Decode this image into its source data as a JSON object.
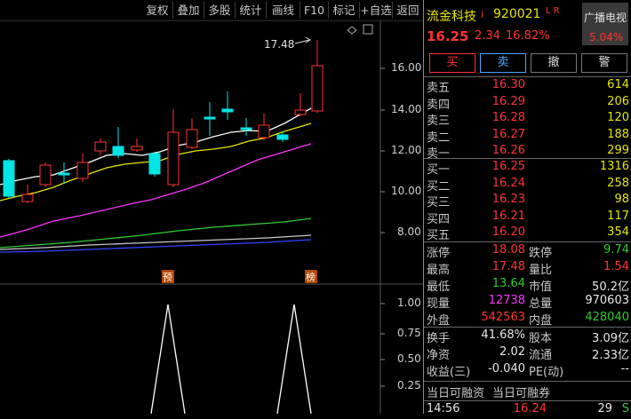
{
  "toolbar": {
    "buttons": [
      "复权",
      "叠加",
      "多股",
      "统计",
      "画线",
      "F10",
      "标记",
      "+自选",
      "返回"
    ]
  },
  "chart": {
    "price_axis": [
      "16.00",
      "14.00",
      "12.00",
      "10.00",
      "8.00"
    ],
    "indicator_axis": [
      "1.00",
      "0.75",
      "0.50",
      "0.25"
    ],
    "high_marker": "17.48",
    "tags": [
      "预",
      "榜"
    ]
  },
  "stock": {
    "name": "流金科技",
    "info_icon": "i",
    "code": "920021",
    "flags": "L R",
    "broadcast_label": "广播电视",
    "sector_change": "5.04%",
    "price": "16.25",
    "change": "2.34",
    "change_pct": "16.82%"
  },
  "actions": {
    "buy": "买",
    "sell": "卖",
    "cancel": "撤",
    "alert": "警"
  },
  "sell_orders": [
    {
      "label": "卖五",
      "price": "16.30",
      "vol": "614"
    },
    {
      "label": "卖四",
      "price": "16.29",
      "vol": "206"
    },
    {
      "label": "卖三",
      "price": "16.28",
      "vol": "120"
    },
    {
      "label": "卖二",
      "price": "16.27",
      "vol": "188"
    },
    {
      "label": "卖一",
      "price": "16.26",
      "vol": "299"
    }
  ],
  "buy_orders": [
    {
      "label": "买一",
      "price": "16.25",
      "vol": "1316"
    },
    {
      "label": "买二",
      "price": "16.24",
      "vol": "258"
    },
    {
      "label": "买三",
      "price": "16.23",
      "vol": "98"
    },
    {
      "label": "买四",
      "price": "16.21",
      "vol": "117"
    },
    {
      "label": "买五",
      "price": "16.20",
      "vol": "354"
    }
  ],
  "stats": {
    "limit_up_label": "涨停",
    "limit_up": "18.08",
    "limit_down_label": "跌停",
    "limit_down": "9.74",
    "high_label": "最高",
    "high": "17.48",
    "vol_ratio_label": "量比",
    "vol_ratio": "1.54",
    "low_label": "最低",
    "low": "13.64",
    "mkt_cap_label": "市值",
    "mkt_cap": "50.2亿",
    "cur_vol_label": "现量",
    "cur_vol": "12738",
    "total_vol_label": "总量",
    "total_vol": "970603",
    "outer_label": "外盘",
    "outer": "542563",
    "inner_label": "内盘",
    "inner": "428040",
    "turnover_label": "换手",
    "turnover": "41.68%",
    "shares_label": "股本",
    "shares": "3.09亿",
    "nav_label": "净资",
    "nav": "2.02",
    "float_label": "流通",
    "float": "2.33亿",
    "eps_label": "收益(三)",
    "eps": "-0.040",
    "pe_label": "PE(动)",
    "pe": "--"
  },
  "margin": {
    "finance_label": "当日可融资",
    "short_label": "当日可融券"
  },
  "tick": {
    "time": "14:56",
    "price": "16.24",
    "vol": "29",
    "side": "S"
  },
  "colors": {
    "up": "#ff3333",
    "down": "#00e5e5",
    "ma5": "#ffffff",
    "ma10": "#e6e600",
    "ma20": "#ff33ff",
    "ma60": "#33cc33",
    "ma120": "#c0c0c0",
    "ma250": "#3344ff"
  }
}
